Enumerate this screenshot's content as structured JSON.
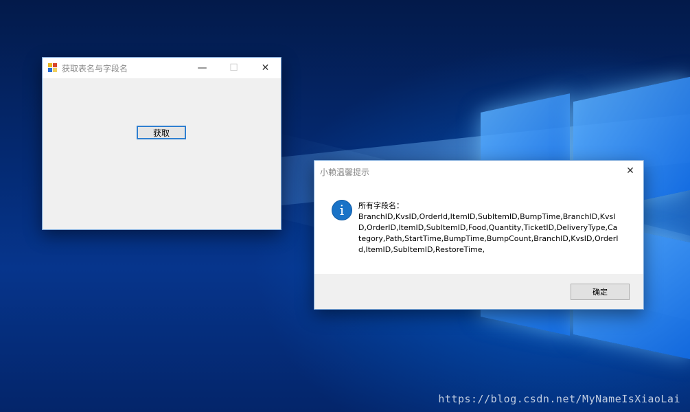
{
  "desktop": {
    "watermark": "https://blog.csdn.net/MyNameIsXiaoLai"
  },
  "main_window": {
    "title": "获取表名与字段名",
    "button_label": "获取",
    "minimize_glyph": "—",
    "maximize_glyph": "☐",
    "close_glyph": "✕"
  },
  "message_box": {
    "title": "小赖温馨提示",
    "icon": "info-icon",
    "message": "所有字段名：\nBranchID,KvsID,OrderId,ItemID,SubItemID,BumpTime,BranchID,KvsID,OrderID,ItemID,SubItemID,Food,Quantity,TicketID,DeliveryType,Category,Path,StartTime,BumpTime,BumpCount,BranchID,KvsID,OrderId,ItemID,SubItemID,RestoreTime,",
    "ok_label": "确定",
    "close_glyph": "✕"
  },
  "colors": {
    "accent": "#2f7fd0",
    "info_icon": "#1a73c7"
  }
}
